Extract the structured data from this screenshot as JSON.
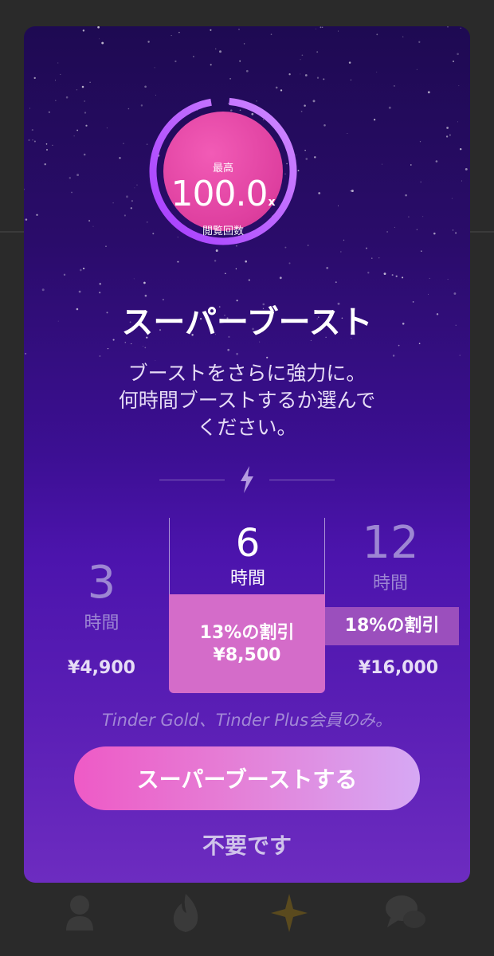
{
  "ring": {
    "top_label": "最高",
    "value": "100.0",
    "suffix": "x",
    "bottom_label": "閲覧回数"
  },
  "title": "スーパーブースト",
  "description": {
    "line1": "ブーストをさらに強力に。",
    "line2": "何時間ブーストするか選んで",
    "line3": "ください。"
  },
  "options": [
    {
      "hours": "3",
      "unit": "時間",
      "price": "¥4,900"
    },
    {
      "hours": "6",
      "unit": "時間",
      "discount": "13%の割引",
      "price": "¥8,500",
      "selected": true
    },
    {
      "hours": "12",
      "unit": "時間",
      "discount": "18%の割引",
      "price": "¥16,000"
    }
  ],
  "members_note": "Tinder Gold、Tinder Plus会員のみ。",
  "cta_label": "スーパーブーストする",
  "dismiss_label": "不要です",
  "colors": {
    "accent_pink": "#e04aa8",
    "modal_purple": "#4c14ad",
    "selected_option": "#d46cc9"
  },
  "tabbar": {
    "icons": [
      "profile-icon",
      "flame-icon",
      "sparkle-icon",
      "chat-icon"
    ]
  }
}
